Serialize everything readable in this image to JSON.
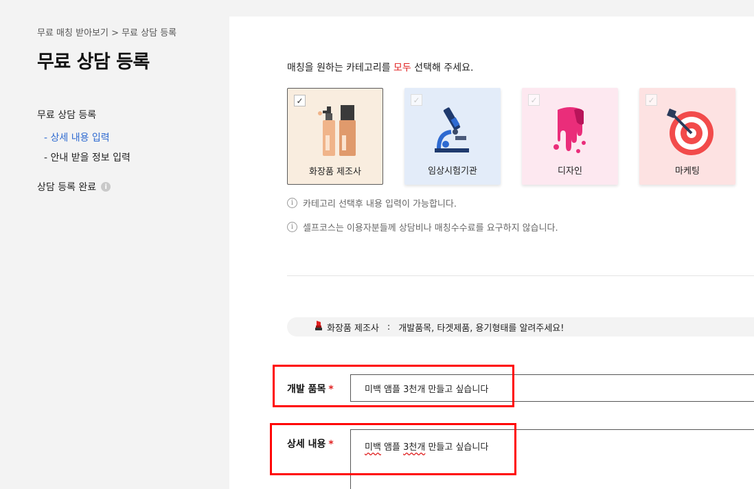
{
  "sidebar": {
    "breadcrumb": "무료 매칭 받아보기 > 무료 상담 등록",
    "title": "무료 상담 등록",
    "nav_main": "무료 상담 등록",
    "nav_sub_active": "- 상세 내용 입력",
    "nav_sub": "- 안내 받을 정보 입력",
    "nav_done": "상담 등록 완료",
    "nav_done_icon": "i"
  },
  "main": {
    "instruction_prefix": "매칭을 원하는 카테고리를 ",
    "instruction_highlight": "모두",
    "instruction_suffix": " 선택해 주세요.",
    "categories": [
      {
        "label": "화장품 제조사",
        "icon": "cosmetics-icon",
        "checked": true,
        "bg": "#f9eddf"
      },
      {
        "label": "임상시험기관",
        "icon": "microscope-icon",
        "checked": false,
        "bg": "#e3ecf9"
      },
      {
        "label": "디자인",
        "icon": "paint-drip-icon",
        "checked": false,
        "bg": "#fde8f0"
      },
      {
        "label": "마케팅",
        "icon": "target-icon",
        "checked": false,
        "bg": "#fde2e2"
      }
    ],
    "check_mark": "✓",
    "note_icon": "i",
    "note1": "카테고리 선택후 내용 입력이 가능합니다.",
    "note2": "셀프코스는 이용자분들께 상담비나 매칭수수료를 요구하지 않습니다.",
    "banner": {
      "category": "화장품 제조사",
      "separator": ":",
      "text": "개발품목, 타겟제품, 용기형태를 알려주세요!"
    },
    "fields": {
      "product_label": "개발 품목",
      "product_value": "미백 앰플 3천개 만들고 싶습니다",
      "detail_label": "상세 내용",
      "detail_value_w1": "미백",
      "detail_value_m1": " 앰플 ",
      "detail_value_w2": "3천개",
      "detail_value_m2": " 만들고 싶습니다",
      "required_mark": "*"
    }
  },
  "colors": {
    "accent_blue": "#2e6ad1",
    "highlight_red": "#e02020",
    "annotation_red": "#ff0000"
  }
}
